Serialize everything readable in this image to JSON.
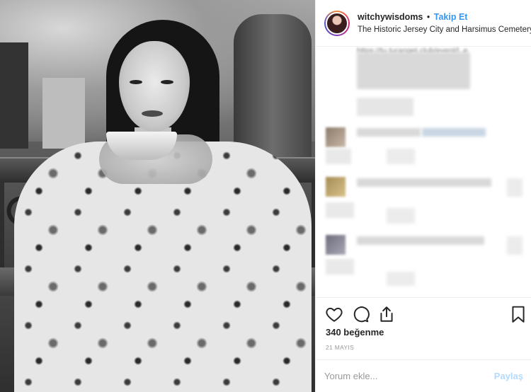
{
  "post": {
    "username": "witchywisdoms",
    "separator": "•",
    "follow_label": "Takip Et",
    "location": "The Historic Jersey City and Harsimus Cemetery",
    "caption_link_partial": "https://tu.turanget.club/event/l..e"
  },
  "actions": {
    "like_icon": "heart-icon",
    "comment_icon": "comment-icon",
    "share_icon": "share-icon",
    "save_icon": "bookmark-icon"
  },
  "likes_text": "340 beğenme",
  "date_text": "21 MAYIS",
  "comment_box": {
    "placeholder": "Yorum ekle...",
    "post_label": "Paylaş"
  },
  "colors": {
    "follow_blue": "#3897f0",
    "post_disabled": "#b3dbff",
    "text": "#262626",
    "muted": "#999999",
    "divider": "#efefef"
  }
}
